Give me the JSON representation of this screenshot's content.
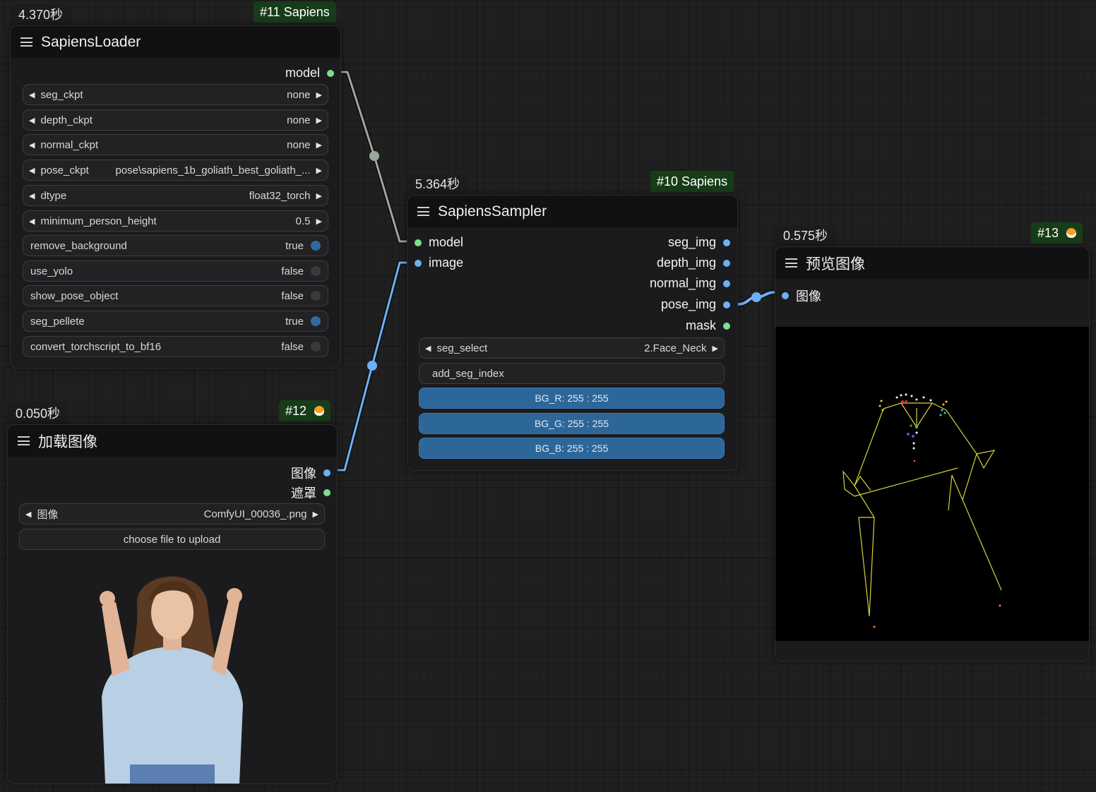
{
  "colors": {
    "canvas": "#202020",
    "node_body": "#1b1b1d",
    "node_header": "#111113",
    "badge": "#173c18",
    "slot_model": "#7be08a",
    "slot_image": "#6db0f5",
    "link_model": "#9aa89a",
    "link_image": "#6db0f5",
    "slider_fill": "#2d6699"
  },
  "node11": {
    "time": "4.370秒",
    "badge": "#11 Sapiens",
    "title": "SapiensLoader",
    "outputs": {
      "model": "model"
    },
    "widgets": [
      {
        "name": "seg_ckpt",
        "value": "none"
      },
      {
        "name": "depth_ckpt",
        "value": "none"
      },
      {
        "name": "normal_ckpt",
        "value": "none"
      },
      {
        "name": "pose_ckpt",
        "value": "pose\\sapiens_1b_goliath_best_goliath_..."
      },
      {
        "name": "dtype",
        "value": "float32_torch"
      },
      {
        "name": "minimum_person_height",
        "value": "0.5"
      }
    ],
    "toggles": [
      {
        "name": "remove_background",
        "value": "true"
      },
      {
        "name": "use_yolo",
        "value": "false"
      },
      {
        "name": "show_pose_object",
        "value": "false"
      },
      {
        "name": "seg_pellete",
        "value": "true"
      },
      {
        "name": "convert_torchscript_to_bf16",
        "value": "false"
      }
    ]
  },
  "node10": {
    "time": "5.364秒",
    "badge": "#10 Sapiens",
    "title": "SapiensSampler",
    "inputs": {
      "model": "model",
      "image": "image"
    },
    "outputs": {
      "seg_img": "seg_img",
      "depth_img": "depth_img",
      "normal_img": "normal_img",
      "pose_img": "pose_img",
      "mask": "mask"
    },
    "seg_select": {
      "name": "seg_select",
      "value": "2.Face_Neck"
    },
    "add_seg_index": "add_seg_index",
    "sliders": [
      "BG_R: 255 : 255",
      "BG_G: 255 : 255",
      "BG_B: 255 : 255"
    ]
  },
  "node12": {
    "time": "0.050秒",
    "badge": "#12",
    "title": "加载图像",
    "outputs": {
      "image": "图像",
      "mask": "遮罩"
    },
    "image_widget": {
      "name": "图像",
      "value": "ComfyUI_00036_.png"
    },
    "upload_button": "choose file to upload"
  },
  "node13": {
    "time": "0.575秒",
    "badge": "#13",
    "title": "预览图像",
    "inputs": {
      "image": "图像"
    }
  }
}
